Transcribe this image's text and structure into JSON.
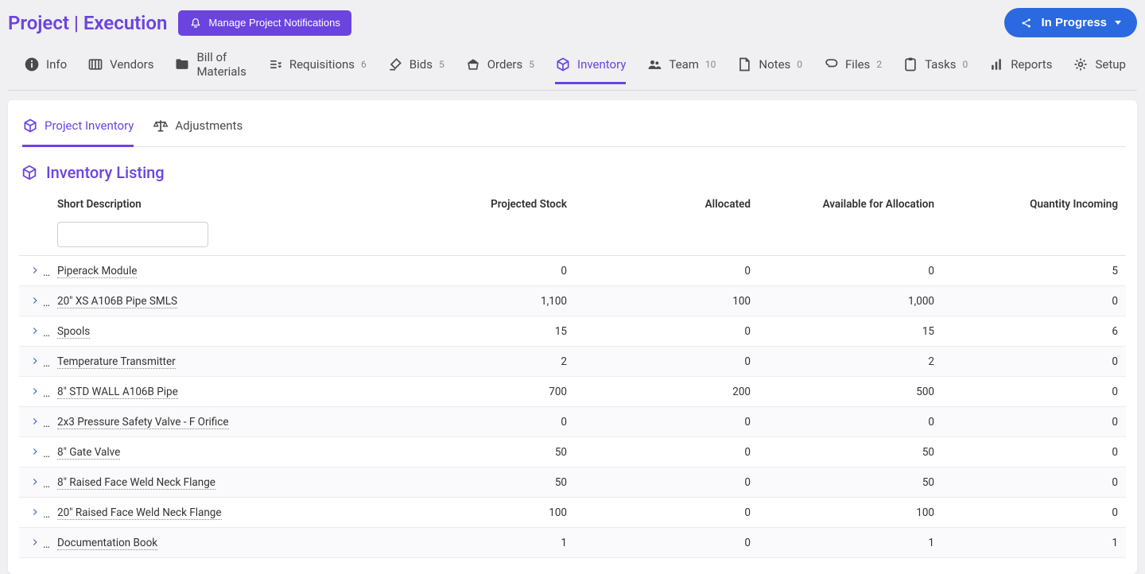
{
  "header": {
    "title": "Project | Execution",
    "manage_btn": "Manage Project Notifications",
    "status_btn": "In Progress"
  },
  "nav": [
    {
      "icon": "info",
      "label": "Info"
    },
    {
      "icon": "vendors",
      "label": "Vendors"
    },
    {
      "icon": "bom",
      "label": "Bill of Materials"
    },
    {
      "icon": "req",
      "label": "Requisitions",
      "count": "6"
    },
    {
      "icon": "bids",
      "label": "Bids",
      "count": "5"
    },
    {
      "icon": "orders",
      "label": "Orders",
      "count": "5"
    },
    {
      "icon": "inv",
      "label": "Inventory",
      "active": true
    },
    {
      "icon": "team",
      "label": "Team",
      "count": "10"
    },
    {
      "icon": "notes",
      "label": "Notes",
      "count": "0"
    },
    {
      "icon": "files",
      "label": "Files",
      "count": "2"
    },
    {
      "icon": "tasks",
      "label": "Tasks",
      "count": "0"
    },
    {
      "icon": "reports",
      "label": "Reports"
    },
    {
      "icon": "setup",
      "label": "Setup"
    }
  ],
  "subtabs": {
    "project_inventory": "Project Inventory",
    "adjustments": "Adjustments"
  },
  "listing_title": "Inventory Listing",
  "columns": {
    "short_description": "Short Description",
    "projected_stock": "Projected Stock",
    "allocated": "Allocated",
    "available": "Available for Allocation",
    "incoming": "Quantity Incoming"
  },
  "filter": {
    "short_description": ""
  },
  "rows": [
    {
      "desc": "Piperack Module",
      "projected": "0",
      "allocated": "0",
      "available": "0",
      "incoming": "5"
    },
    {
      "desc": "20\" XS A106B Pipe SMLS",
      "projected": "1,100",
      "allocated": "100",
      "available": "1,000",
      "incoming": "0"
    },
    {
      "desc": "Spools",
      "projected": "15",
      "allocated": "0",
      "available": "15",
      "incoming": "6"
    },
    {
      "desc": "Temperature Transmitter",
      "projected": "2",
      "allocated": "0",
      "available": "2",
      "incoming": "0"
    },
    {
      "desc": "8\" STD WALL A106B Pipe",
      "projected": "700",
      "allocated": "200",
      "available": "500",
      "incoming": "0"
    },
    {
      "desc": "2x3 Pressure Safety Valve - F Orifice",
      "projected": "0",
      "allocated": "0",
      "available": "0",
      "incoming": "0"
    },
    {
      "desc": "8\" Gate Valve",
      "projected": "50",
      "allocated": "0",
      "available": "50",
      "incoming": "0"
    },
    {
      "desc": "8\" Raised Face Weld Neck Flange",
      "projected": "50",
      "allocated": "0",
      "available": "50",
      "incoming": "0"
    },
    {
      "desc": "20\" Raised Face Weld Neck Flange",
      "projected": "100",
      "allocated": "0",
      "available": "100",
      "incoming": "0"
    },
    {
      "desc": "Documentation Book",
      "projected": "1",
      "allocated": "0",
      "available": "1",
      "incoming": "1"
    }
  ]
}
